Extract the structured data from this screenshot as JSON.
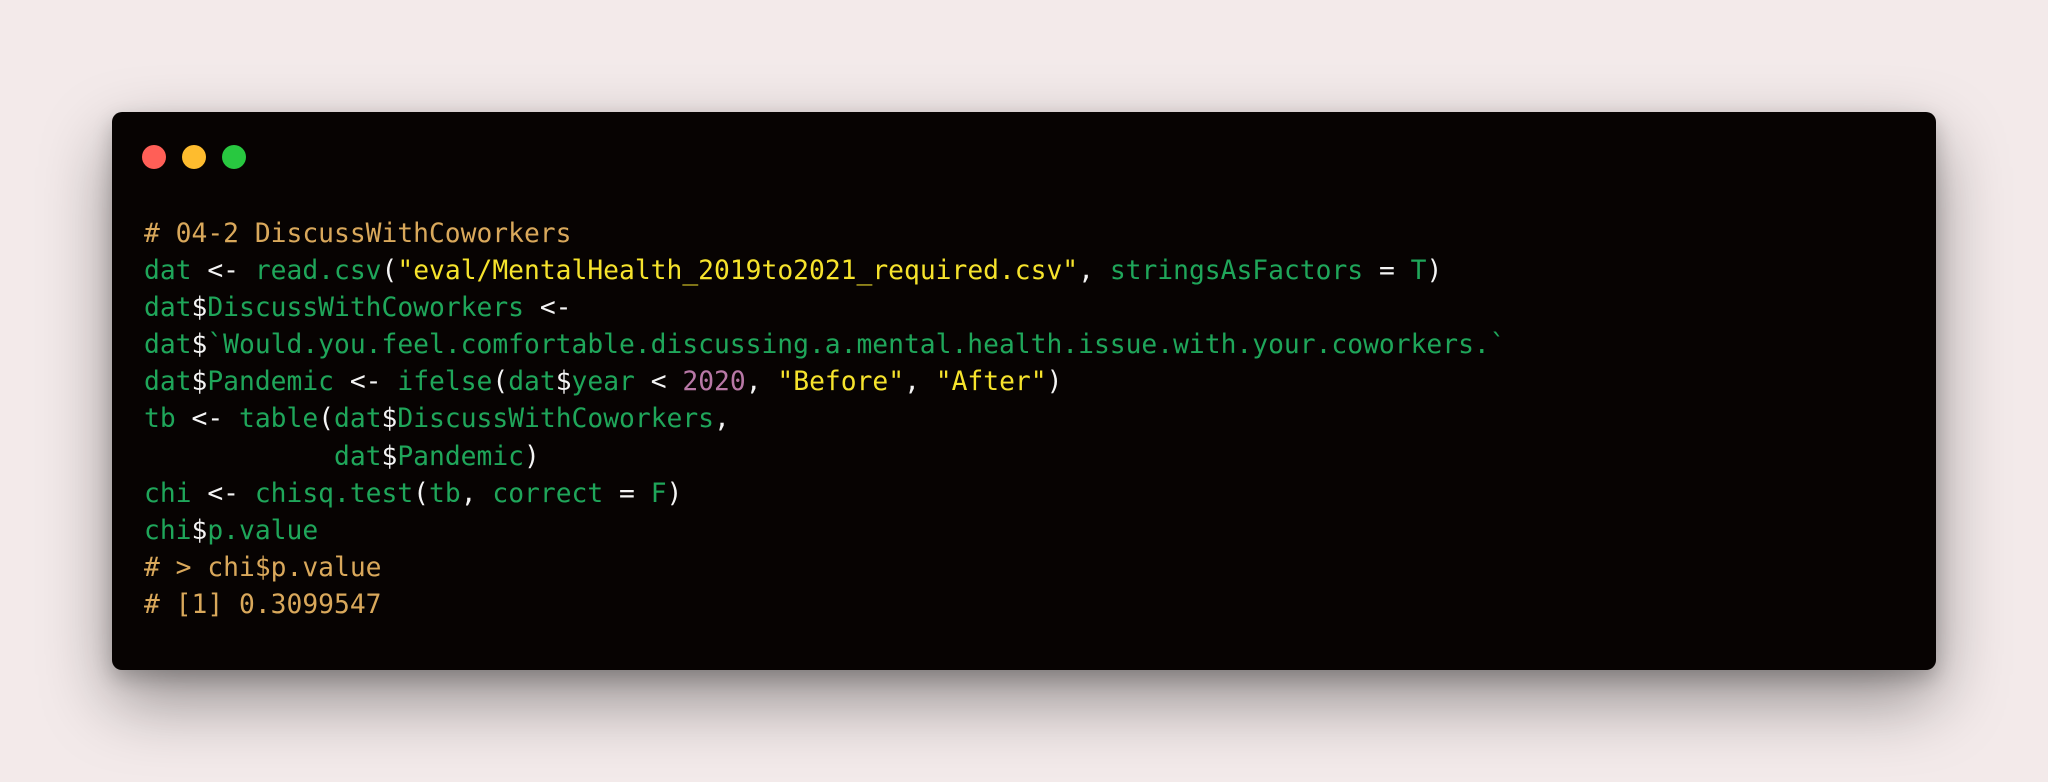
{
  "window": {
    "controls": [
      {
        "name": "close-dot",
        "color": "#ff5f57"
      },
      {
        "name": "minimize-dot",
        "color": "#febc2e"
      },
      {
        "name": "maximize-dot",
        "color": "#28c840"
      }
    ]
  },
  "colors": {
    "background": "#f3eaea",
    "window": "#070302",
    "comment": "#d9a85b",
    "identifier": "#1fa65a",
    "operator": "#f4f4f4",
    "string": "#f6e32c",
    "number": "#b878a6"
  },
  "code": {
    "lines": [
      [
        [
          "comment",
          "# 04-2 DiscussWithCoworkers"
        ]
      ],
      [
        [
          "id",
          "dat"
        ],
        [
          "op",
          " <- "
        ],
        [
          "id",
          "read.csv"
        ],
        [
          "op",
          "("
        ],
        [
          "str",
          "\"eval/MentalHealth_2019to2021_required.csv\""
        ],
        [
          "op",
          ", "
        ],
        [
          "id",
          "stringsAsFactors"
        ],
        [
          "op",
          " = "
        ],
        [
          "id",
          "T"
        ],
        [
          "op",
          ")"
        ]
      ],
      [
        [
          "id",
          "dat"
        ],
        [
          "op",
          "$"
        ],
        [
          "id",
          "DiscussWithCoworkers"
        ],
        [
          "op",
          " <-"
        ]
      ],
      [
        [
          "id",
          "dat"
        ],
        [
          "op",
          "$"
        ],
        [
          "id",
          "`Would.you.feel.comfortable.discussing.a.mental.health.issue.with.your.coworkers.`"
        ]
      ],
      [
        [
          "id",
          "dat"
        ],
        [
          "op",
          "$"
        ],
        [
          "id",
          "Pandemic"
        ],
        [
          "op",
          " <- "
        ],
        [
          "id",
          "ifelse"
        ],
        [
          "op",
          "("
        ],
        [
          "id",
          "dat"
        ],
        [
          "op",
          "$"
        ],
        [
          "id",
          "year"
        ],
        [
          "op",
          " < "
        ],
        [
          "num",
          "2020"
        ],
        [
          "op",
          ", "
        ],
        [
          "str",
          "\"Before\""
        ],
        [
          "op",
          ", "
        ],
        [
          "str",
          "\"After\""
        ],
        [
          "op",
          ")"
        ]
      ],
      [
        [
          "id",
          "tb"
        ],
        [
          "op",
          " <- "
        ],
        [
          "id",
          "table"
        ],
        [
          "op",
          "("
        ],
        [
          "id",
          "dat"
        ],
        [
          "op",
          "$"
        ],
        [
          "id",
          "DiscussWithCoworkers"
        ],
        [
          "op",
          ","
        ]
      ],
      [
        [
          "op",
          "            "
        ],
        [
          "id",
          "dat"
        ],
        [
          "op",
          "$"
        ],
        [
          "id",
          "Pandemic"
        ],
        [
          "op",
          ")"
        ]
      ],
      [
        [
          "id",
          "chi"
        ],
        [
          "op",
          " <- "
        ],
        [
          "id",
          "chisq.test"
        ],
        [
          "op",
          "("
        ],
        [
          "id",
          "tb"
        ],
        [
          "op",
          ", "
        ],
        [
          "id",
          "correct"
        ],
        [
          "op",
          " = "
        ],
        [
          "id",
          "F"
        ],
        [
          "op",
          ")"
        ]
      ],
      [
        [
          "id",
          "chi"
        ],
        [
          "op",
          "$"
        ],
        [
          "id",
          "p.value"
        ]
      ],
      [
        [
          "comment",
          "# > chi$p.value"
        ]
      ],
      [
        [
          "comment",
          "# [1] 0.3099547"
        ]
      ]
    ]
  }
}
